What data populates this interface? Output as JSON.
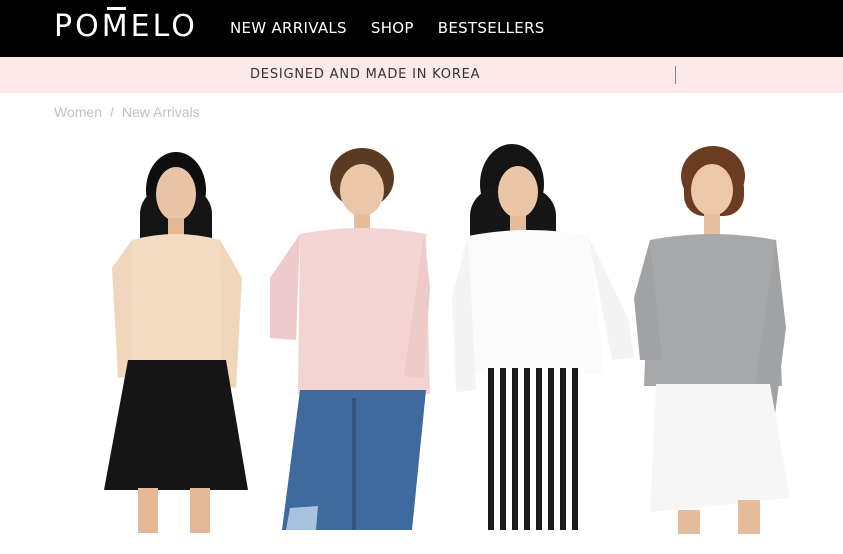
{
  "brand": {
    "logo": "POMELO"
  },
  "nav": {
    "items": [
      {
        "label": "NEW ARRIVALS"
      },
      {
        "label": "SHOP"
      },
      {
        "label": "BESTSELLERS"
      }
    ]
  },
  "promo": {
    "text": "DESIGNED AND MADE IN KOREA"
  },
  "breadcrumb": {
    "items": [
      {
        "label": "Women"
      },
      {
        "label": "New Arrivals"
      }
    ],
    "separator": "/"
  },
  "hero": {
    "models": [
      {
        "top": "sheer lace blouse",
        "bottom": "black leather skirt"
      },
      {
        "top": "pink blouse",
        "bottom": "ripped jeans"
      },
      {
        "top": "white shirt",
        "bottom": "striped trousers"
      },
      {
        "top": "grey sweatshirt",
        "bottom": "white skirt"
      }
    ]
  },
  "colors": {
    "header_bg": "#000000",
    "promo_bg": "#fde8ea",
    "breadcrumb": "#c2c2c2"
  }
}
